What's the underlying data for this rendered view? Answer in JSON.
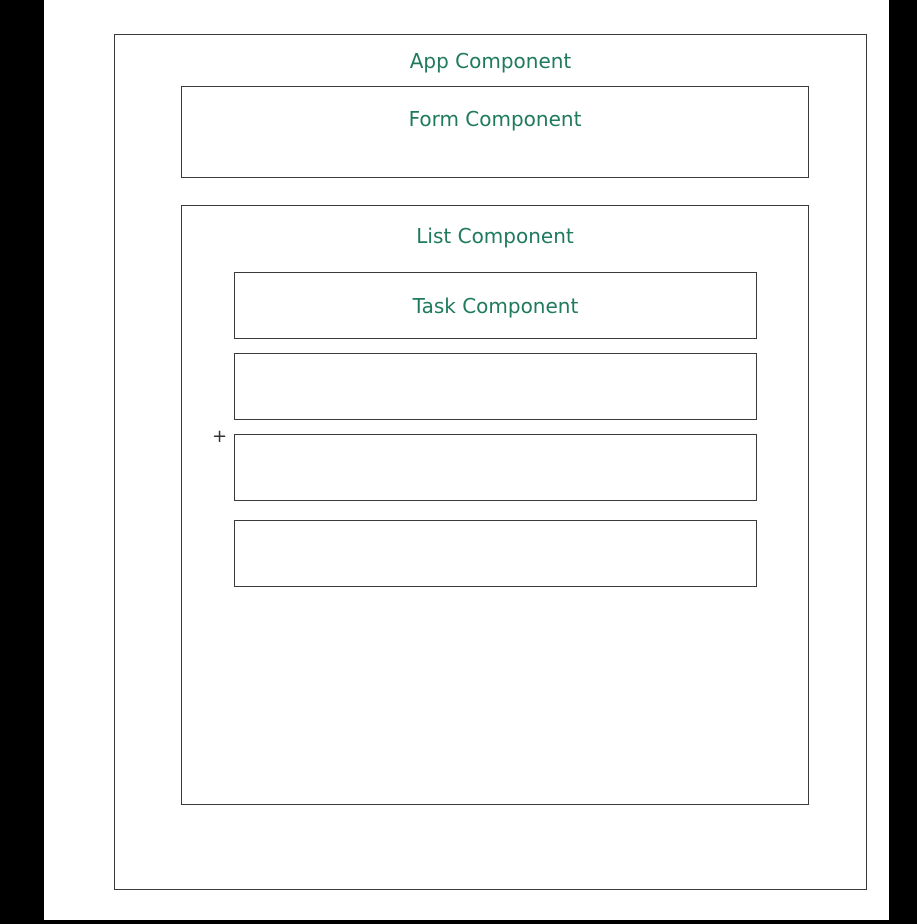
{
  "app": {
    "label": "App Component"
  },
  "form": {
    "label": "Form Component"
  },
  "list": {
    "label": "List Component"
  },
  "tasks": [
    {
      "label": "Task Component"
    },
    {
      "label": ""
    },
    {
      "label": ""
    },
    {
      "label": ""
    }
  ],
  "cursor": {
    "glyph": "+"
  },
  "colors": {
    "label_text": "#1f7a5e",
    "box_border": "#3a3a3a",
    "background": "#ffffff",
    "letterbox": "#000000"
  }
}
